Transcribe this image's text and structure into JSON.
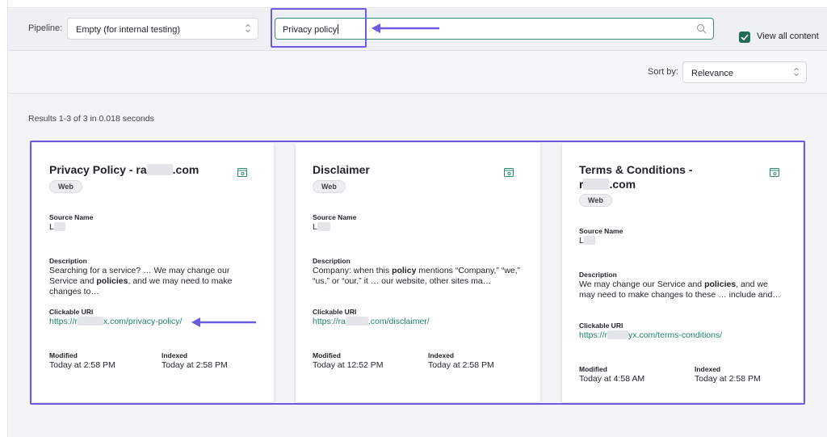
{
  "header": {
    "pipeline_label": "Pipeline:",
    "pipeline_value": "Empty (for internal testing)",
    "search_value": "Privacy policy",
    "view_all_label": "View all content",
    "view_all_checked": true
  },
  "sort": {
    "label": "Sort by:",
    "value": "Relevance"
  },
  "results": {
    "summary": "Results 1-3 of 3 in 0.018 seconds",
    "cards": [
      {
        "title_prefix": "Privacy Policy - ra",
        "title_suffix": ".com",
        "badge": "Web",
        "source_name_label": "Source Name",
        "source_name_value": "L",
        "description_label": "Description",
        "description_parts": [
          "Searching for a service? … We may change our Service and ",
          "policies",
          ", and we may need to make changes to…"
        ],
        "uri_label": "Clickable URI",
        "uri_prefix": "https://r",
        "uri_suffix": "x.com/privacy-policy/",
        "modified_label": "Modified",
        "modified_value": "Today at 2:58 PM",
        "indexed_label": "Indexed",
        "indexed_value": "Today at 2:58 PM"
      },
      {
        "title": "Disclaimer",
        "badge": "Web",
        "source_name_label": "Source Name",
        "source_name_value": "L",
        "description_label": "Description",
        "description_parts": [
          "Company: when this ",
          "policy",
          " mentions “Company,” “we,” “us,” or “our,” it … our website, other sites ma…"
        ],
        "uri_label": "Clickable URI",
        "uri_prefix": "https://ra",
        "uri_suffix": ".com/disclaimer/",
        "modified_label": "Modified",
        "modified_value": "Today at 12:52 PM",
        "indexed_label": "Indexed",
        "indexed_value": "Today at 2:58 PM"
      },
      {
        "title_line1": "Terms & Conditions -",
        "title_prefix": "r",
        "title_suffix": ".com",
        "badge": "Web",
        "source_name_label": "Source Name",
        "source_name_value": "L",
        "description_label": "Description",
        "description_parts": [
          "We may change our Service and ",
          "policies",
          ", and we may need to make changes to these … include and…"
        ],
        "uri_label": "Clickable URI",
        "uri_prefix": "https://r",
        "uri_suffix": "yx.com/terms-conditions/",
        "modified_label": "Modified",
        "modified_value": "Today at 4:58 AM",
        "indexed_label": "Indexed",
        "indexed_value": "Today at 2:58 PM"
      }
    ]
  },
  "colors": {
    "accent_green": "#226b5a",
    "link_green": "#1e7f6a",
    "highlight_purple": "#6a5be0"
  },
  "icons": [
    "chevron-updown-icon",
    "search-icon",
    "checkmark-icon",
    "open-in-viewer-icon",
    "annotation-arrow"
  ]
}
